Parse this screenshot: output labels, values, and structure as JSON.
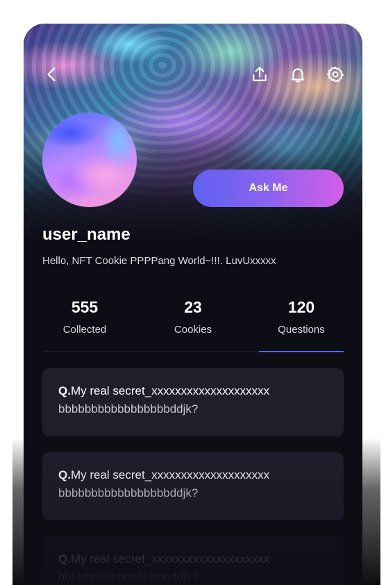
{
  "header": {
    "back_icon": "chevron-left-icon",
    "share_icon": "share-upload-icon",
    "notification_icon": "bell-icon",
    "settings_icon": "gear-icon"
  },
  "profile": {
    "username": "user_name",
    "bio": "Hello, NFT Cookie PPPPang World~!!!. LuvUxxxxx",
    "ask_button_label": "Ask Me"
  },
  "stats": [
    {
      "value": "555",
      "label": "Collected"
    },
    {
      "value": "23",
      "label": "Cookies"
    },
    {
      "value": "120",
      "label": "Questions"
    }
  ],
  "active_tab": "Questions",
  "questions": [
    {
      "prefix": "Q.",
      "line1": "My real secret_xxxxxxxxxxxxxxxxxxxx",
      "line2": "bbbbbbbbbbbbbbbbbddjk?"
    },
    {
      "prefix": "Q.",
      "line1": "My real secret_xxxxxxxxxxxxxxxxxxxx",
      "line2": "bbbbbbbbbbbbbbbbbddjk?"
    },
    {
      "prefix": "Q.",
      "line1": "My real secret_xxxxxxxxxxxxxxxxxxxx",
      "line2": "bbbbbbbbbbbbbbbbbddjk?"
    }
  ],
  "colors": {
    "accent_start": "#5f62f2",
    "accent_end": "#d55ee6",
    "background": "#0d0d16",
    "card": "#1e1f2b"
  }
}
